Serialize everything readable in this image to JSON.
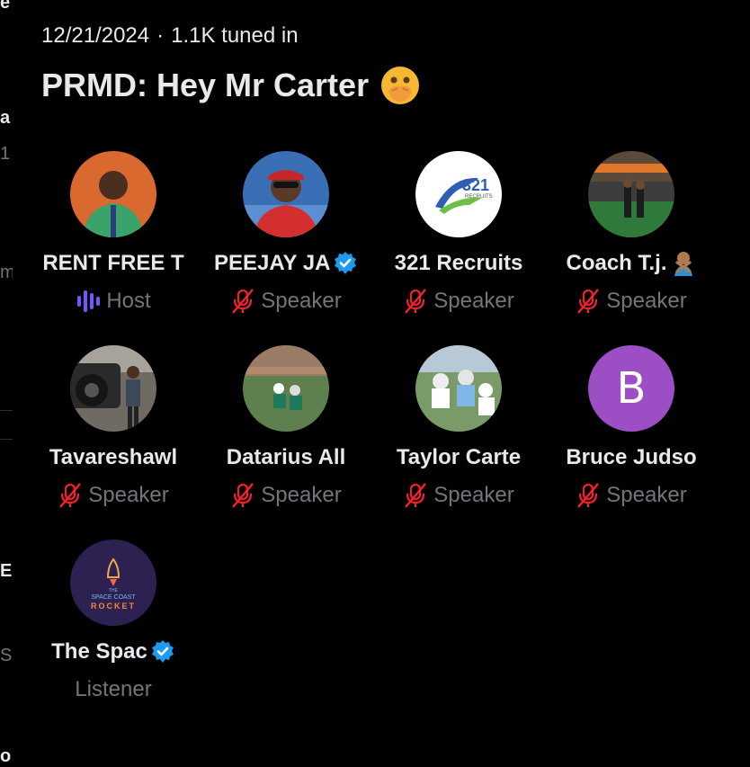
{
  "meta": {
    "date": "12/21/2024",
    "separator": "·",
    "tuned_in": "1.1K tuned in"
  },
  "space": {
    "title": "PRMD: Hey Mr Carter"
  },
  "background_fragments": {
    "items": [
      "e",
      "a",
      "1",
      "m",
      "E",
      "S",
      "o"
    ]
  },
  "participants": [
    {
      "name": "RENT FREE T",
      "role": "Host",
      "verified": false,
      "icon": "host-audio-bars-icon",
      "avatar_icon": "photo-avatar"
    },
    {
      "name": "PEEJAY JA",
      "role": "Speaker",
      "verified": true,
      "icon": "mic-muted-icon",
      "avatar_icon": "photo-avatar"
    },
    {
      "name": "321 Recruits",
      "role": "Speaker",
      "verified": false,
      "icon": "mic-muted-icon",
      "avatar_icon": "logo-avatar"
    },
    {
      "name": "Coach T.j.",
      "role": "Speaker",
      "verified": false,
      "icon": "mic-muted-icon",
      "avatar_icon": "photo-avatar",
      "emoji": "person-gesturing-no-emoji"
    },
    {
      "name": "Tavareshawl",
      "role": "Speaker",
      "verified": false,
      "icon": "mic-muted-icon",
      "avatar_icon": "photo-avatar"
    },
    {
      "name": "Datarius All",
      "role": "Speaker",
      "verified": false,
      "icon": "mic-muted-icon",
      "avatar_icon": "photo-avatar"
    },
    {
      "name": "Taylor Carte",
      "role": "Speaker",
      "verified": false,
      "icon": "mic-muted-icon",
      "avatar_icon": "photo-avatar"
    },
    {
      "name": "Bruce Judso",
      "role": "Speaker",
      "verified": false,
      "icon": "mic-muted-icon",
      "avatar_icon": "initial-avatar",
      "initial": "B"
    },
    {
      "name": "The Spac",
      "role": "Listener",
      "verified": true,
      "icon": "none",
      "avatar_icon": "logo-avatar",
      "logo_text": [
        "THE",
        "SPACE COAST",
        "ROCKET"
      ]
    }
  ],
  "colors": {
    "text_primary": "#e7e9ea",
    "text_secondary": "#71767b",
    "host_bars": "#7856ff",
    "muted_mic": "#f4212e",
    "verified": "#1d9bf0",
    "initial_avatar": "#9c4fc4"
  }
}
